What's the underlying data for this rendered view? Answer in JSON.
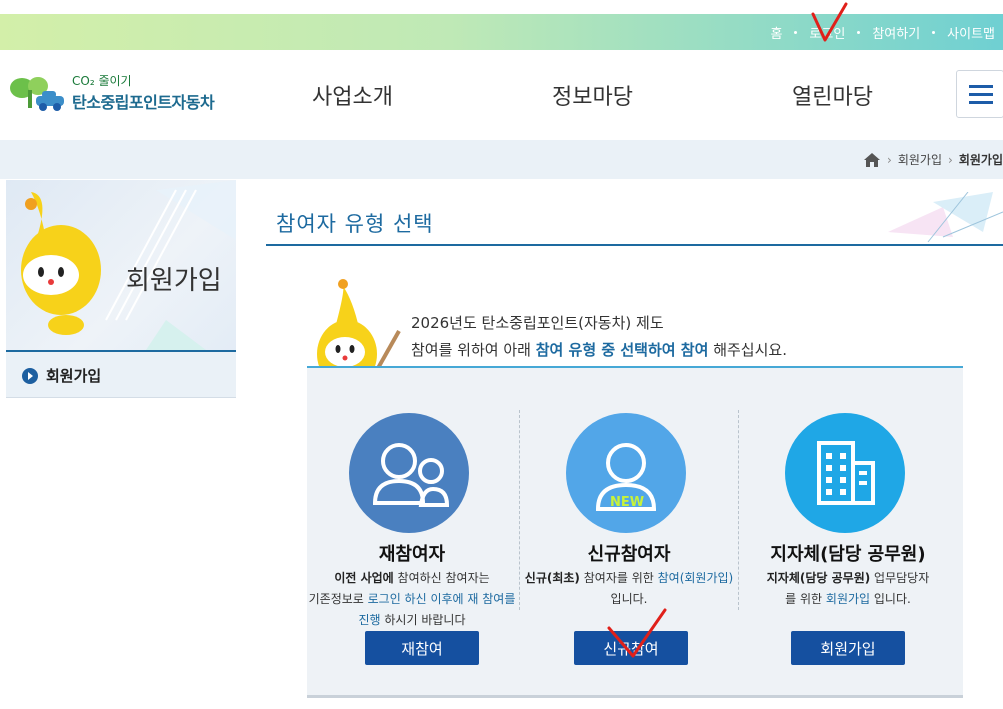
{
  "topnav": {
    "items": [
      "홈",
      "로그인",
      "참여하기",
      "사이트맵"
    ]
  },
  "logo": {
    "sub": "CO₂ 줄이기",
    "main": "탄소중립포인트자동차"
  },
  "gnb": {
    "items": [
      "사업소개",
      "정보마당",
      "열린마당"
    ]
  },
  "breadcrumb": {
    "items": [
      "회원가입",
      "회원가입"
    ]
  },
  "sidebar": {
    "title": "회원가입",
    "menu_item": "회원가입"
  },
  "main": {
    "title": "참여자 유형 선택",
    "intro_line1": "2026년도 탄소중립포인트(자동차) 제도",
    "intro_line2_pre": "참여를 위하여 아래 ",
    "intro_line2_hl": "참여 유형 중 선택하여 참여",
    "intro_line2_post": " 해주십시요.",
    "options": [
      {
        "title": "재참여자",
        "desc_b": "이전 사업에",
        "desc_1": " 참여하신 참여자는",
        "desc_2": "기존정보로 ",
        "desc_bl": "로그인 하신 이후에 재 참여를 진행",
        "desc_3": " 하시기 바랍니다",
        "button": "재참여"
      },
      {
        "title": "신규참여자",
        "new_badge": "NEW",
        "desc_b": "신규(최초)",
        "desc_1": " 참여자를 위한 ",
        "desc_bl": "참여(회원가입)",
        "desc_2": " 입니다.",
        "button": "신규참여"
      },
      {
        "title": "지자체(담당 공무원)",
        "desc_b": "지자체(담당 공무원)",
        "desc_1": " 업무담당자",
        "desc_2": "를 위한 ",
        "desc_bl": "회원가입",
        "desc_3": " 입니다.",
        "button": "회원가입"
      }
    ]
  },
  "colors": {
    "primary_blue": "#1550a0",
    "accent_teal": "#46a8d6",
    "circle_1": "#4a80c0",
    "circle_2": "#52a6e8",
    "circle_3": "#1fa7e6",
    "annotation_red": "#e0201a"
  }
}
